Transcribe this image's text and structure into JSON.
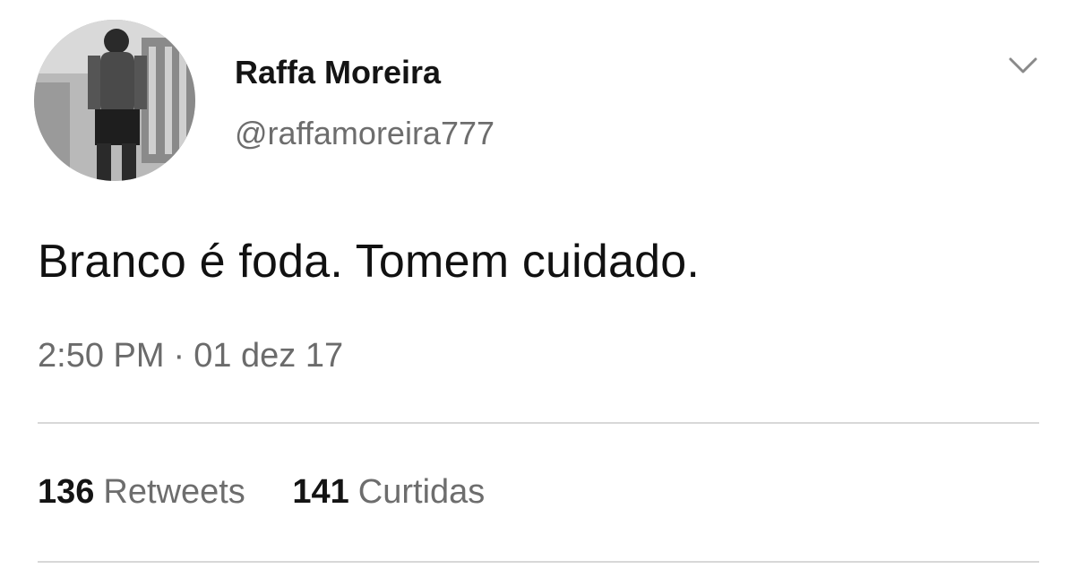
{
  "author": {
    "display_name": "Raffa Moreira",
    "handle": "@raffamoreira777"
  },
  "tweet": {
    "text": "Branco é foda. Tomem cuidado.",
    "time": "2:50 PM",
    "separator": "·",
    "date": "01 dez 17"
  },
  "stats": {
    "retweets_count": "136",
    "retweets_label": "Retweets",
    "likes_count": "141",
    "likes_label": "Curtidas"
  },
  "icons": {
    "menu": "chevron-down-icon"
  },
  "colors": {
    "text": "#141414",
    "muted": "#6d6d6d",
    "divider": "#d8d8d8"
  }
}
